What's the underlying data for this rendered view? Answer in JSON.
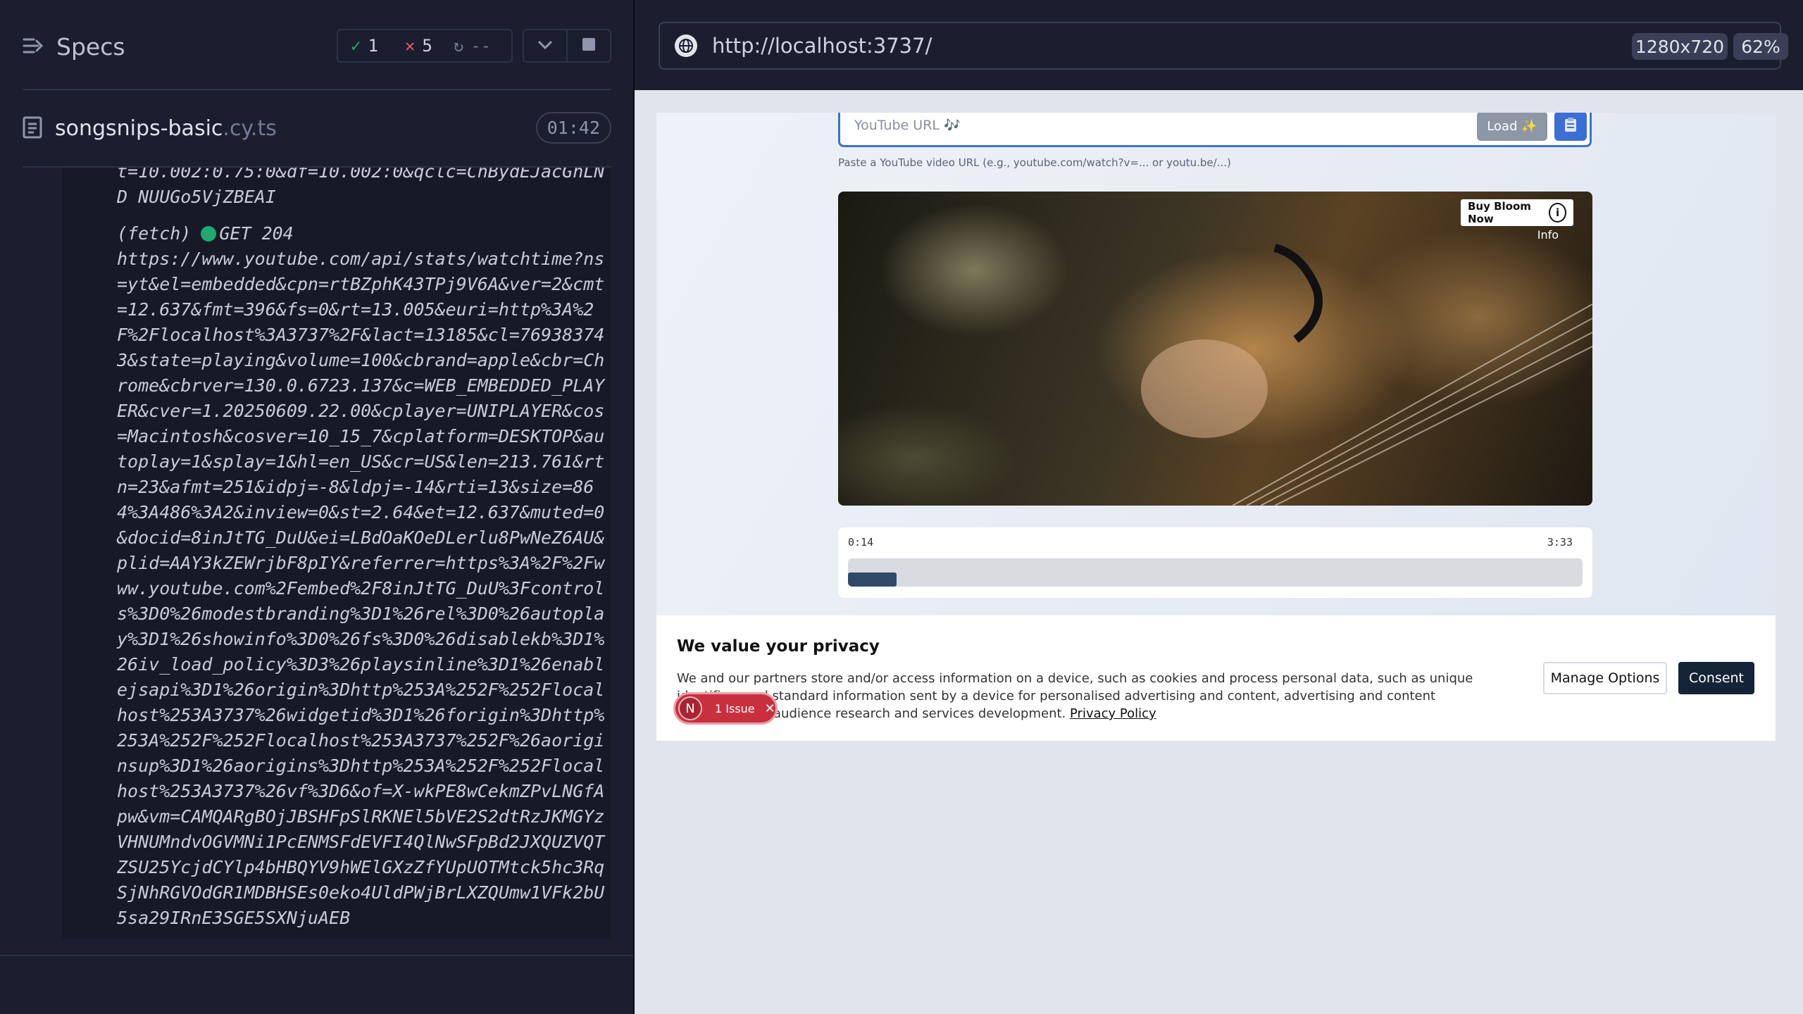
{
  "reporter": {
    "title": "Specs",
    "stats": {
      "passed": "1",
      "failed": "5",
      "pending": "--"
    },
    "file": {
      "name": "songsnips-basic",
      "ext": ".cy.ts",
      "duration": "01:42"
    },
    "log": {
      "prev_tail": "t=10.002:0.75:0&df=10.002:0&qclc=ChBydEJacGhLND NUUGo5VjZBEAI",
      "entry_label": "(fetch)",
      "entry_method": "GET 204",
      "entry_url": "https://www.youtube.com/api/stats/watchtime?ns=yt&el=embedded&cpn=rtBZphK43TPj9V6A&ver=2&cmt=12.637&fmt=396&fs=0&rt=13.005&euri=http%3A%2F%2Flocalhost%3A3737%2F&lact=13185&cl=769383743&state=playing&volume=100&cbrand=apple&cbr=Chrome&cbrver=130.0.6723.137&c=WEB_EMBEDDED_PLAYER&cver=1.20250609.22.00&cplayer=UNIPLAYER&cos=Macintosh&cosver=10_15_7&cplatform=DESKTOP&autoplay=1&splay=1&hl=en_US&cr=US&len=213.761&rtn=23&afmt=251&idpj=-8&ldpj=-14&rti=13&size=864%3A486%3A2&inview=0&st=2.64&et=12.637&muted=0&docid=8inJtTG_DuU&ei=LBdOaKOeDLerlu8PwNeZ6AU&plid=AAY3kZEWrjbF8pIY&referrer=https%3A%2F%2Fwww.youtube.com%2Fembed%2F8inJtTG_DuU%3Fcontrols%3D0%26modestbranding%3D1%26rel%3D0%26autoplay%3D1%26showinfo%3D0%26fs%3D0%26disablekb%3D1%26iv_load_policy%3D3%26playsinline%3D1%26enablejsapi%3D1%26origin%3Dhttp%253A%252F%252Flocalhost%253A3737%26widgetid%3D1%26forigin%3Dhttp%253A%252F%252Flocalhost%253A3737%252F%26aoriginsup%3D1%26aorigins%3Dhttp%253A%252F%252Flocalhost%253A3737%26vf%3D6&of=X-wkPE8wCekmZPvLNGfApw&vm=CAMQARgBOjJBSHFpSlRKNEl5bVE2S2dtRzJKMGYzVHNUMndvOGVMNi1PcENMSFdEVFI4QlNwSFpBd2JXQUZVQTZSU25YcjdCYlp4bHBQYV9hWElGXzZfYUpUOTMtck5hc3RqSjNhRGVOdGR1MDBHSEs0eko4UldPWjBrLXZQUmw1VFk2bU5sa29IRnE3SGE5SXNjuAEB"
    }
  },
  "browser": {
    "url": "http://localhost:3737/",
    "viewport_size": "1280x720",
    "zoom": "62%"
  },
  "app": {
    "input_placeholder": "YouTube URL 🎶",
    "load_label": "Load ✨",
    "paste_icon": "clipboard-icon",
    "helper_text": "Paste a YouTube video URL (e.g., youtube.com/watch?v=... or youtu.be/...)",
    "video": {
      "ad_label": "Buy Bloom Now",
      "info_label": "Info"
    },
    "timeline": {
      "current": "0:14",
      "total": "3:33",
      "progress_fraction": 0.066
    }
  },
  "consent": {
    "title": "We value your privacy",
    "body": "We and our partners store and/or access information on a device, such as cookies and process personal data, such as unique identifiers and standard information sent by a device for personalised advertising and content, advertising and content measurement, audience research and services development.",
    "privacy_link": "Privacy Policy",
    "manage_label": "Manage Options",
    "consent_label": "Consent"
  },
  "issue_badge": {
    "initial": "N",
    "label": "1 Issue"
  },
  "colors": {
    "pass": "#1fa971",
    "fail": "#e45770",
    "accent": "#3b74c9",
    "consent_button": "#152338",
    "issue": "#c8303e"
  }
}
